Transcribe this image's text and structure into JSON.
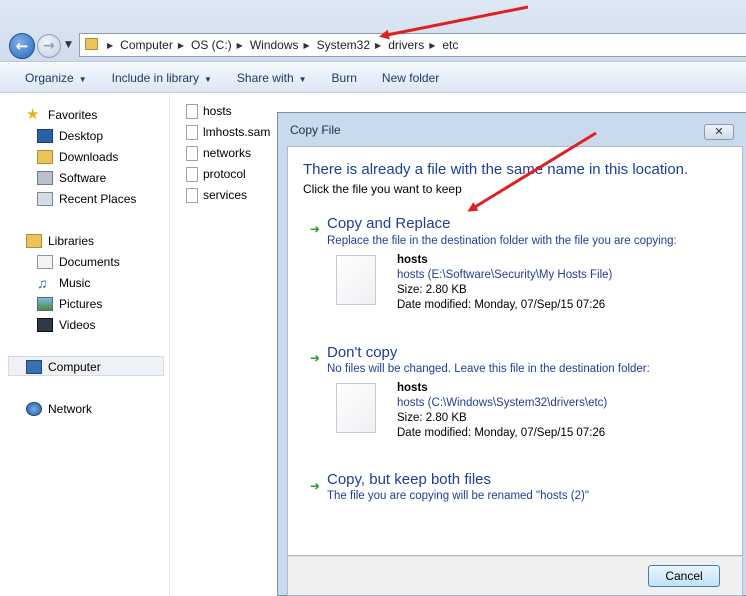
{
  "address": {
    "crumbs": [
      "Computer",
      "OS (C:)",
      "Windows",
      "System32",
      "drivers",
      "etc"
    ]
  },
  "toolbar": {
    "organize": "Organize",
    "include_in_library": "Include in library",
    "share_with": "Share with",
    "burn": "Burn",
    "new_folder": "New folder"
  },
  "navpane": {
    "favorites": "Favorites",
    "desktop": "Desktop",
    "downloads": "Downloads",
    "software": "Software",
    "recent_places": "Recent Places",
    "libraries": "Libraries",
    "documents": "Documents",
    "music": "Music",
    "pictures": "Pictures",
    "videos": "Videos",
    "computer": "Computer",
    "network": "Network"
  },
  "files": [
    "hosts",
    "lmhosts.sam",
    "networks",
    "protocol",
    "services"
  ],
  "dialog": {
    "title": "Copy File",
    "close": "✕",
    "headline": "There is already a file with the same name in this location.",
    "subhead": "Click the file you want to keep",
    "option1": {
      "title": "Copy and Replace",
      "desc": "Replace the file in the destination folder with the file you are copying:",
      "file_name": "hosts",
      "file_path": "hosts (E:\\Software\\Security\\My Hosts File)",
      "file_size": "Size: 2.80 KB",
      "file_date": "Date modified: Monday, 07/Sep/15 07:26"
    },
    "option2": {
      "title": "Don't copy",
      "desc": "No files will be changed. Leave this file in the destination folder:",
      "file_name": "hosts",
      "file_path": "hosts (C:\\Windows\\System32\\drivers\\etc)",
      "file_size": "Size: 2.80 KB",
      "file_date": "Date modified: Monday, 07/Sep/15 07:26"
    },
    "option3": {
      "title": "Copy, but keep both files",
      "desc": "The file you are copying will be renamed \"hosts (2)\""
    },
    "cancel": "Cancel"
  },
  "colors": {
    "link_blue": "#1f3e96",
    "annotation_red": "#e02020",
    "option_arrow_green": "#2c9b2c"
  }
}
